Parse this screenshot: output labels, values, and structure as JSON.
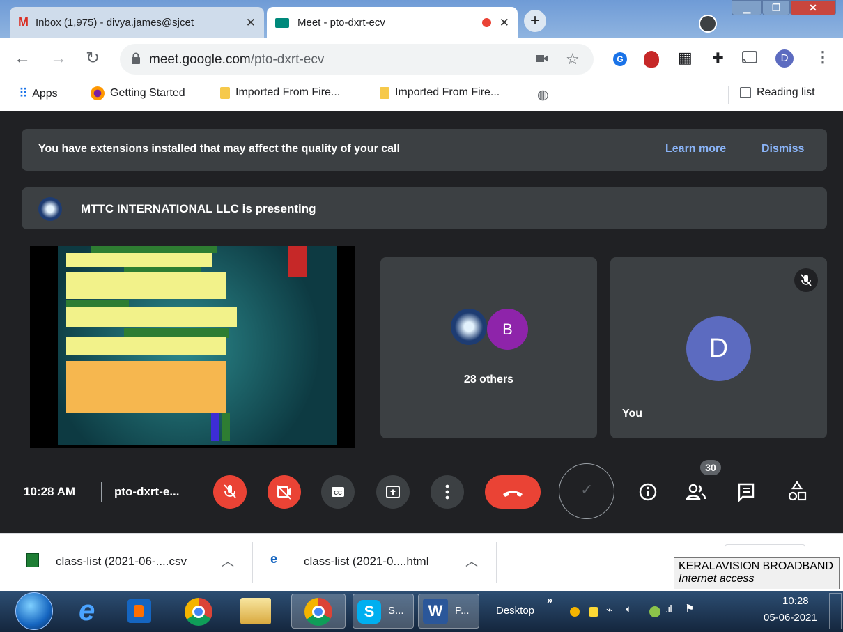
{
  "browser": {
    "tabs": [
      {
        "title": "Inbox (1,975) - divya.james@sjcet",
        "icon": "gmail-icon"
      },
      {
        "title": "Meet - pto-dxrt-ecv",
        "icon": "meet-icon"
      }
    ],
    "url_host": "meet.google.com",
    "url_path": "/pto-dxrt-ecv",
    "profile_initial": "D",
    "bookmarks": [
      "Apps",
      "Getting Started",
      "Imported From Fire...",
      "Imported From Fire..."
    ],
    "reading_list": "Reading list"
  },
  "meet": {
    "extension_banner": "You have extensions installed that may affect the quality of your call",
    "learn_more": "Learn more",
    "dismiss": "Dismiss",
    "presenting_text": "MTTC INTERNATIONAL LLC is presenting",
    "others_count": "28 others",
    "avatar_b": "B",
    "self_initial": "D",
    "self_label": "You",
    "time": "10:28 AM",
    "meeting_code": "pto-dxrt-e...",
    "participants_badge": "30",
    "colors": {
      "accent": "#8ab4f8",
      "red": "#ea4335",
      "self_avatar": "#5c6bc0",
      "b_avatar": "#8e24aa"
    }
  },
  "downloads": [
    {
      "name": "class-list (2021-06-....csv"
    },
    {
      "name": "class-list (2021-0....html"
    }
  ],
  "tooltip": {
    "title": "KERALAVISION BROADBAND",
    "subtitle": "Internet access"
  },
  "taskbar": {
    "skype_label": "S...",
    "word_label": "P...",
    "desktop_label": "Desktop",
    "clock_time": "10:28",
    "clock_date": "05-06-2021"
  }
}
